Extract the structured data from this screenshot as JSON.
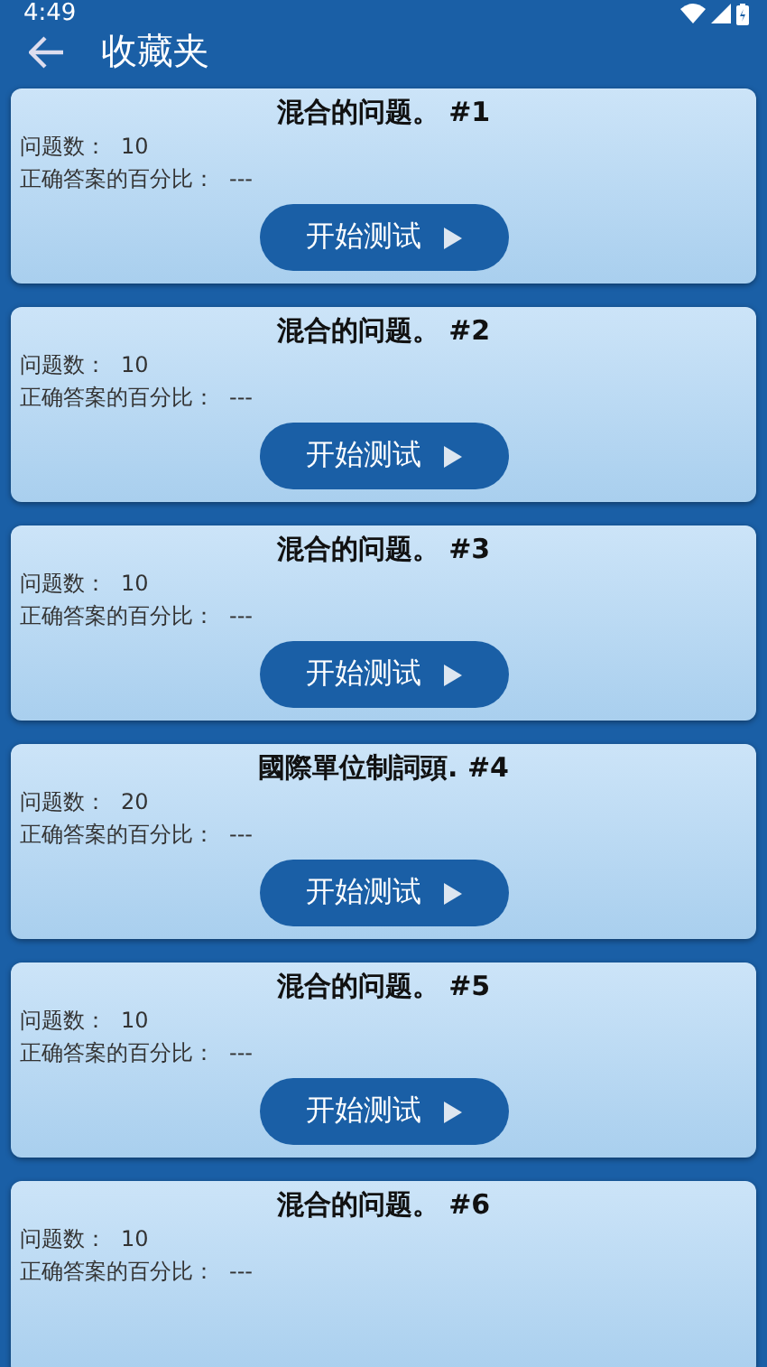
{
  "status_bar": {
    "time": "4:49"
  },
  "toolbar": {
    "title": "收藏夹"
  },
  "quizzes": [
    {
      "title": "混合的问题。 #1",
      "count_label": "问题数：",
      "count": "10",
      "percent_label": "正确答案的百分比：",
      "percent": "---",
      "button": "开始测试"
    },
    {
      "title": "混合的问题。 #2",
      "count_label": "问题数：",
      "count": "10",
      "percent_label": "正确答案的百分比：",
      "percent": "---",
      "button": "开始测试"
    },
    {
      "title": "混合的问题。 #3",
      "count_label": "问题数：",
      "count": "10",
      "percent_label": "正确答案的百分比：",
      "percent": "---",
      "button": "开始测试"
    },
    {
      "title": "國際單位制詞頭. #4",
      "count_label": "问题数：",
      "count": "20",
      "percent_label": "正确答案的百分比：",
      "percent": "---",
      "button": "开始测试"
    },
    {
      "title": "混合的问题。 #5",
      "count_label": "问题数：",
      "count": "10",
      "percent_label": "正确答案的百分比：",
      "percent": "---",
      "button": "开始测试"
    },
    {
      "title": "混合的问题。 #6",
      "count_label": "问题数：",
      "count": "10",
      "percent_label": "正确答案的百分比：",
      "percent": "---"
    }
  ]
}
